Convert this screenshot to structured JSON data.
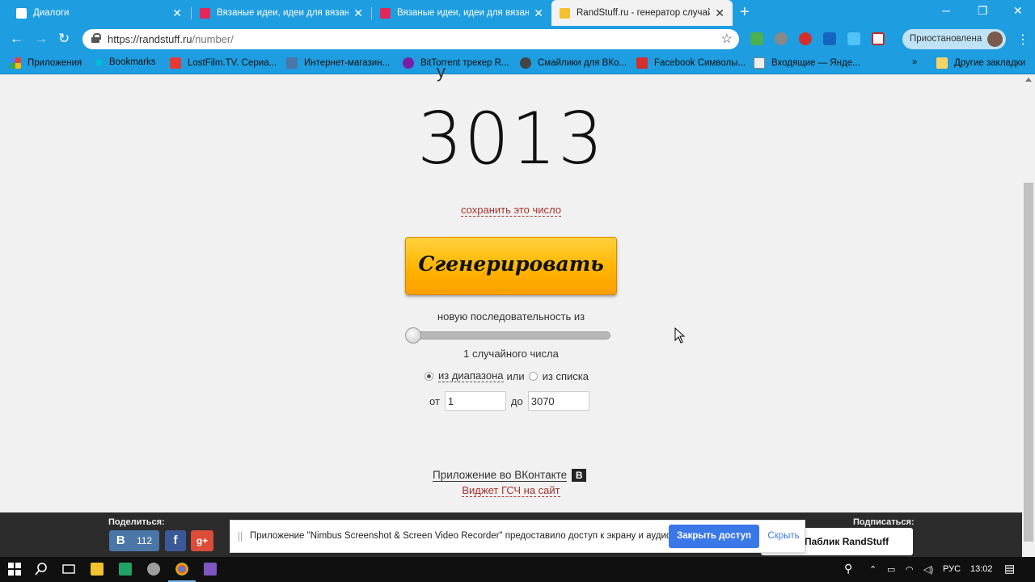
{
  "tabs": [
    {
      "title": "Диалоги",
      "active": false
    },
    {
      "title": "Вязаные идеи, идеи для вязания",
      "active": false
    },
    {
      "title": "Вязаные идеи, идеи для вязания",
      "active": false
    },
    {
      "title": "RandStuff.ru - генератор случайных",
      "active": true
    }
  ],
  "address_bar": {
    "scheme_host": "https://randstuff.ru",
    "path": "/number/"
  },
  "profile": {
    "status": "Приостановлена"
  },
  "bookmarks": [
    "Приложения",
    "Bookmarks",
    "LostFilm.TV. Сериа...",
    "Интернет-магазин...",
    "BitTorrent трекер R...",
    "Смайлики для ВКо...",
    "Facebook Символы...",
    "Входящие — Янде...",
    "Другие закладки"
  ],
  "main": {
    "number": "3013",
    "save_link": "сохранить это число",
    "generate_button": "Сгенерировать",
    "sequence_label": "новую последовательность из",
    "count_slider_value": 1,
    "count_label": "1 случайного числа",
    "mode": {
      "range_label": "из диапазона",
      "or_label": "или",
      "list_label": "из списка",
      "selected": "range"
    },
    "range": {
      "from_label": "от",
      "from_value": "1",
      "to_label": "до",
      "to_value": "3070"
    },
    "vk_app_link": "Приложение во ВКонтакте",
    "vk_badge": "В",
    "widget_link": "Виджет ГСЧ на сайт"
  },
  "footer": {
    "share_label": "Поделиться:",
    "vk_share_letter": "В",
    "vk_share_count": "112",
    "subscribe_label": "Подписаться:",
    "public_label": "Паблик RandStuff"
  },
  "nimbus_bar": {
    "message": "Приложение \"Nimbus Screenshot & Screen Video Recorder\" предоставило доступ к экрану и аудио.",
    "stop_button": "Закрыть доступ",
    "hide_button": "Скрыть"
  },
  "taskbar": {
    "language": "РУС",
    "time": "13:02"
  },
  "colors": {
    "chrome_blue": "#1e9de0",
    "link_red": "#a5332e",
    "button_orange": "#ffb400",
    "nimbus_blue": "#3b78e7"
  }
}
